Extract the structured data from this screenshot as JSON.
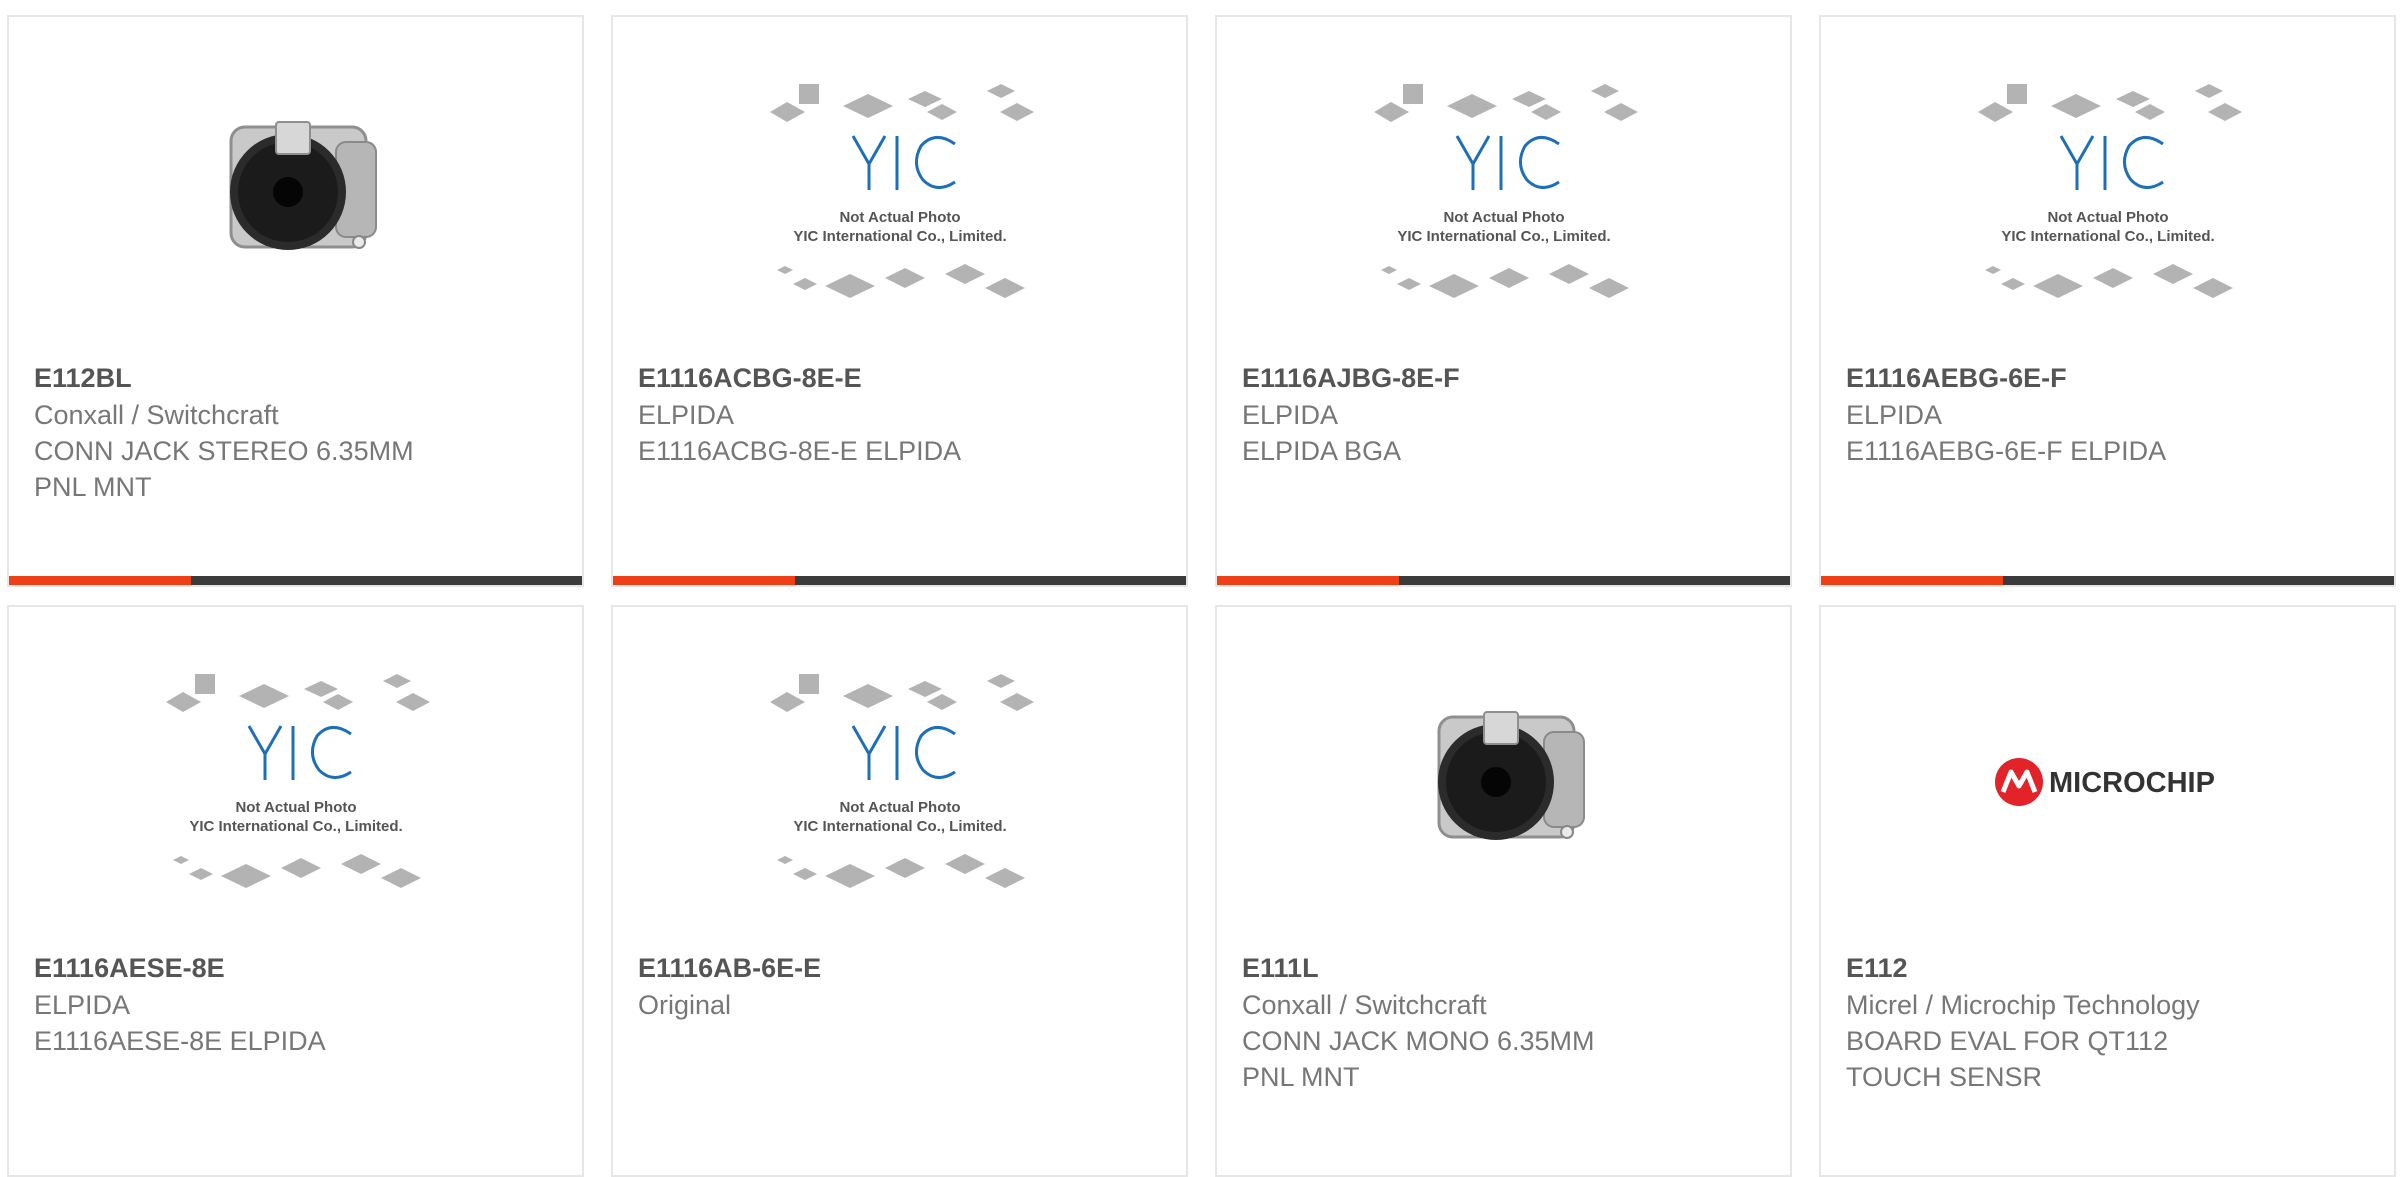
{
  "colors": {
    "accent": "#ee3f16",
    "bar": "#3b3b3b",
    "border": "#e6e6e6",
    "yic_blue": "#1e6fb8",
    "microchip_red": "#e2232a"
  },
  "products": [
    {
      "part": "E112BL",
      "maker": "Conxall / Switchcraft",
      "desc1": "CONN JACK STEREO 6.35MM",
      "desc2": "PNL MNT",
      "image": "jack-icon",
      "bar": true
    },
    {
      "part": "E1116ACBG-8E-E",
      "maker": "ELPIDA",
      "desc1": "E1116ACBG-8E-E ELPIDA",
      "desc2": "",
      "image": "yic-placeholder",
      "bar": true
    },
    {
      "part": "E1116AJBG-8E-F",
      "maker": "ELPIDA",
      "desc1": "ELPIDA BGA",
      "desc2": "",
      "image": "yic-placeholder",
      "bar": true
    },
    {
      "part": "E1116AEBG-6E-F",
      "maker": "ELPIDA",
      "desc1": "E1116AEBG-6E-F ELPIDA",
      "desc2": "",
      "image": "yic-placeholder",
      "bar": true
    },
    {
      "part": "E1116AESE-8E",
      "maker": "ELPIDA",
      "desc1": "E1116AESE-8E ELPIDA",
      "desc2": "",
      "image": "yic-placeholder",
      "bar": false
    },
    {
      "part": "E1116AB-6E-E",
      "maker": "Original",
      "desc1": "",
      "desc2": "",
      "image": "yic-placeholder",
      "bar": false
    },
    {
      "part": "E111L",
      "maker": "Conxall / Switchcraft",
      "desc1": "CONN JACK MONO 6.35MM",
      "desc2": "PNL MNT",
      "image": "jack-icon",
      "bar": false
    },
    {
      "part": "E112",
      "maker": "Micrel / Microchip Technology",
      "desc1": "BOARD EVAL FOR QT112",
      "desc2": "TOUCH SENSR",
      "image": "microchip-logo",
      "bar": false
    }
  ],
  "placeholder": {
    "logo": "YIC",
    "line1": "Not Actual Photo",
    "line2": "YIC International Co., Limited."
  },
  "microchip_logo_text": "MICROCHIP"
}
